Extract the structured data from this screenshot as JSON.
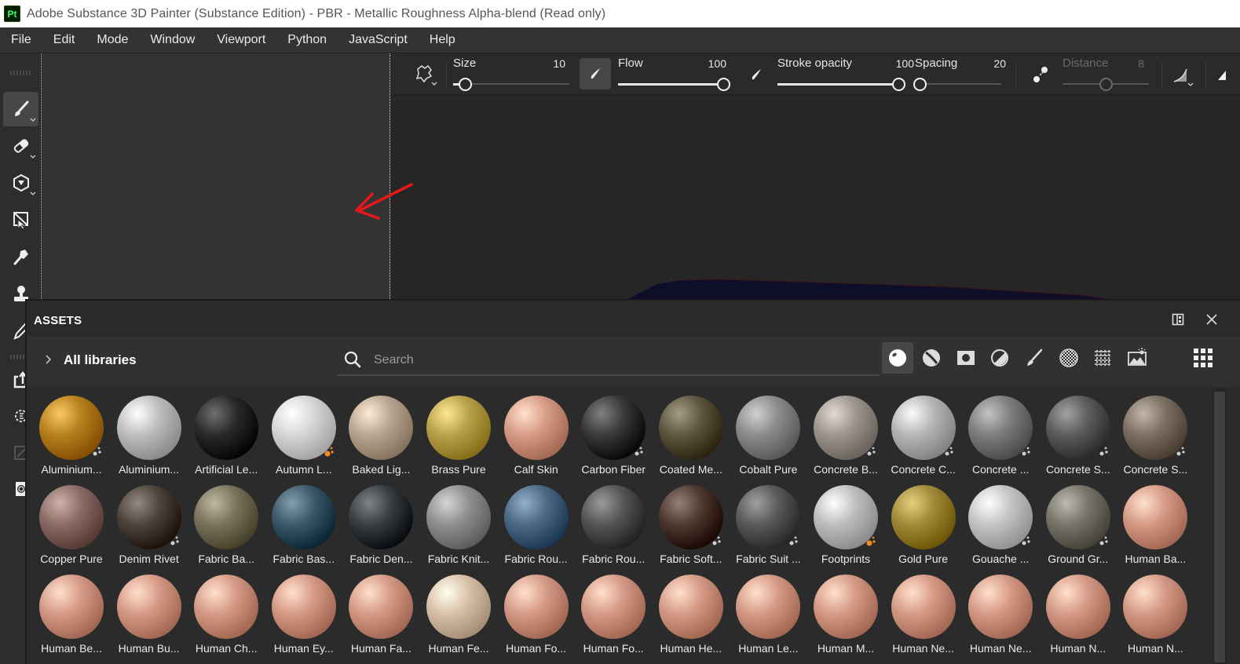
{
  "window": {
    "app_logo": "Pt",
    "title": "Adobe Substance 3D Painter (Substance Edition) - PBR - Metallic Roughness Alpha-blend (Read only)"
  },
  "menu": [
    "File",
    "Edit",
    "Mode",
    "Window",
    "Viewport",
    "Python",
    "JavaScript",
    "Help"
  ],
  "left_tools": [
    {
      "name": "paint-brush-icon",
      "active": true,
      "has_menu": true
    },
    {
      "name": "eraser-icon",
      "active": false,
      "has_menu": true
    },
    {
      "name": "projection-icon",
      "active": false,
      "has_menu": true
    },
    {
      "name": "polygon-fill-icon",
      "active": false,
      "has_menu": false
    },
    {
      "name": "smudge-icon",
      "active": false,
      "has_menu": false
    },
    {
      "name": "clone-stamp-icon",
      "active": false,
      "has_menu": false
    },
    {
      "name": "color-picker-icon",
      "active": false,
      "has_menu": false
    },
    {
      "name": "export-icon",
      "active": false,
      "has_menu": false
    },
    {
      "name": "bake-settings-icon",
      "active": false,
      "has_menu": false
    },
    {
      "name": "share-icon",
      "active": false,
      "has_menu": false
    },
    {
      "name": "camera-icon",
      "active": false,
      "has_menu": false
    }
  ],
  "context_toolbar": {
    "size": {
      "label": "Size",
      "value": "10",
      "fraction": 0.1
    },
    "flow": {
      "label": "Flow",
      "value": "100",
      "fraction": 1.0
    },
    "stroke_opacity": {
      "label": "Stroke opacity",
      "value": "100",
      "fraction": 1.0
    },
    "spacing": {
      "label": "Spacing",
      "value": "20",
      "fraction": 0.05
    },
    "distance": {
      "label": "Distance",
      "value": "8",
      "fraction": 0.5,
      "disabled": true
    }
  },
  "assets": {
    "title": "ASSETS",
    "library_label": "All libraries",
    "search_placeholder": "Search",
    "filters": [
      "smart-material-icon",
      "material-icon",
      "mask-icon",
      "smart-mask-icon",
      "brush-icon",
      "alpha-icon",
      "procedural-icon",
      "environment-icon"
    ],
    "active_filter": 0,
    "items": [
      {
        "label": "Aluminium...",
        "color": "#b7801e",
        "badge": "smart"
      },
      {
        "label": "Aluminium...",
        "color": "#bdbdbd",
        "badge": ""
      },
      {
        "label": "Artificial Le...",
        "color": "#2a2a2a",
        "badge": ""
      },
      {
        "label": "Autumn L...",
        "color": "#d6d6d6",
        "badge": "orange"
      },
      {
        "label": "Baked Lig...",
        "color": "#b7a590",
        "badge": ""
      },
      {
        "label": "Brass Pure",
        "color": "#b9a04a",
        "badge": ""
      },
      {
        "label": "Calf Skin",
        "color": "#d69b86",
        "badge": ""
      },
      {
        "label": "Carbon Fiber",
        "color": "#3a3a3a",
        "badge": "smart"
      },
      {
        "label": "Coated Me...",
        "color": "#5e5640",
        "badge": ""
      },
      {
        "label": "Cobalt Pure",
        "color": "#8b8b8b",
        "badge": ""
      },
      {
        "label": "Concrete B...",
        "color": "#9b958d",
        "badge": "smart"
      },
      {
        "label": "Concrete C...",
        "color": "#b5b5b5",
        "badge": "smart"
      },
      {
        "label": "Concrete ...",
        "color": "#7d7d7d",
        "badge": "smart"
      },
      {
        "label": "Concrete S...",
        "color": "#5c5c5c",
        "badge": "smart"
      },
      {
        "label": "Concrete S...",
        "color": "#7b7063",
        "badge": "smart"
      },
      {
        "label": "Copper Pure",
        "color": "#8a6c66",
        "badge": ""
      },
      {
        "label": "Denim Rivet",
        "color": "#4e443b",
        "badge": "smart"
      },
      {
        "label": "Fabric Ba...",
        "color": "#77735c",
        "badge": ""
      },
      {
        "label": "Fabric Bas...",
        "color": "#3d5866",
        "badge": ""
      },
      {
        "label": "Fabric Den...",
        "color": "#3a3d42",
        "badge": ""
      },
      {
        "label": "Fabric Knit...",
        "color": "#8f8f8f",
        "badge": ""
      },
      {
        "label": "Fabric Rou...",
        "color": "#4c6a85",
        "badge": ""
      },
      {
        "label": "Fabric Rou...",
        "color": "#555555",
        "badge": ""
      },
      {
        "label": "Fabric Soft...",
        "color": "#4e3a30",
        "badge": "smart"
      },
      {
        "label": "Fabric Suit ...",
        "color": "#5a5a5a",
        "badge": "smart"
      },
      {
        "label": "Footprints",
        "color": "#bdbdbd",
        "badge": "orange"
      },
      {
        "label": "Gold Pure",
        "color": "#a08a3a",
        "badge": ""
      },
      {
        "label": "Gouache ...",
        "color": "#c4c4c4",
        "badge": "smart"
      },
      {
        "label": "Ground Gr...",
        "color": "#77746a",
        "badge": "smart"
      },
      {
        "label": "Human Ba...",
        "color": "#d59a86",
        "badge": ""
      },
      {
        "label": "Human Be...",
        "color": "#d59a86",
        "badge": ""
      },
      {
        "label": "Human Bu...",
        "color": "#d59a86",
        "badge": ""
      },
      {
        "label": "Human Ch...",
        "color": "#d59a86",
        "badge": ""
      },
      {
        "label": "Human Ey...",
        "color": "#d59a86",
        "badge": ""
      },
      {
        "label": "Human Fa...",
        "color": "#d59a86",
        "badge": ""
      },
      {
        "label": "Human Fe...",
        "color": "#d8c0a8",
        "badge": ""
      },
      {
        "label": "Human Fo...",
        "color": "#d59a86",
        "badge": ""
      },
      {
        "label": "Human Fo...",
        "color": "#d59a86",
        "badge": ""
      },
      {
        "label": "Human He...",
        "color": "#d59a86",
        "badge": ""
      },
      {
        "label": "Human Le...",
        "color": "#d59a86",
        "badge": ""
      },
      {
        "label": "Human M...",
        "color": "#d59a86",
        "badge": ""
      },
      {
        "label": "Human Ne...",
        "color": "#d59a86",
        "badge": ""
      },
      {
        "label": "Human Ne...",
        "color": "#d59a86",
        "badge": ""
      },
      {
        "label": "Human N...",
        "color": "#d59a86",
        "badge": ""
      },
      {
        "label": "Human N...",
        "color": "#d59a86",
        "badge": ""
      }
    ]
  },
  "colors": {
    "accent_orange": "#f28c1e",
    "annotation_red": "#e81818",
    "mesh_blue": "#0e0e2a"
  }
}
